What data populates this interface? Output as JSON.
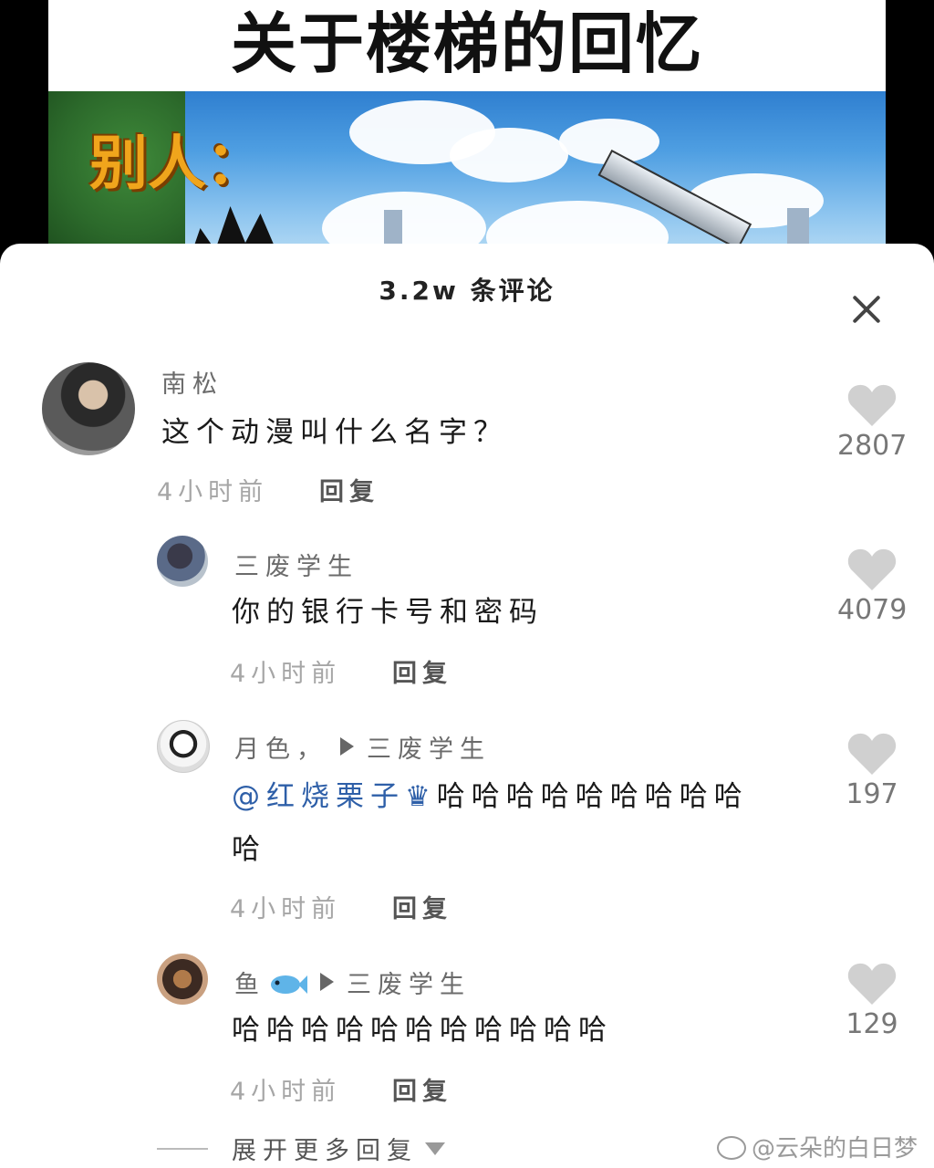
{
  "video": {
    "title": "关于楼梯的回忆",
    "overlay_text": "别人："
  },
  "comments_header": {
    "count_label": "3.2w 条评论"
  },
  "comments": [
    {
      "username": "南松",
      "text": "这个动漫叫什么名字？",
      "time": "4小时前",
      "reply_label": "回复",
      "likes": "2807"
    },
    {
      "username": "三废学生",
      "text": "你的银行卡号和密码",
      "time": "4小时前",
      "reply_label": "回复",
      "likes": "4079"
    },
    {
      "username": "月色，",
      "reply_to": "三废学生",
      "mention": "@红烧栗子",
      "mention_icon": "crown-icon",
      "text": "哈哈哈哈哈哈哈哈哈",
      "text_line2": "哈",
      "time": "4小时前",
      "reply_label": "回复",
      "likes": "197"
    },
    {
      "username": "鱼",
      "username_icon": "fish-icon",
      "reply_to": "三废学生",
      "text": "哈哈哈哈哈哈哈哈哈哈哈",
      "time": "4小时前",
      "reply_label": "回复",
      "likes": "129"
    }
  ],
  "expand_more": {
    "label": "展开更多回复"
  },
  "watermark": {
    "text": "@云朵的白日梦"
  }
}
